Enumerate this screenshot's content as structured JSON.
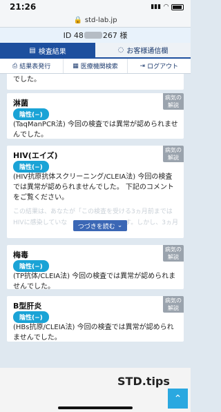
{
  "status_bar": {
    "time": "21:26"
  },
  "browser": {
    "url": "std-lab.jp"
  },
  "id_bar": {
    "prefix": "ID 48",
    "suffix": "267 様"
  },
  "tabs": [
    {
      "label": "検査結果"
    },
    {
      "label": "お客様通信欄"
    }
  ],
  "subnav": [
    {
      "label": "結果表発行"
    },
    {
      "label": "医療機関検索"
    },
    {
      "label": "ログアウト"
    }
  ],
  "top_fragment": "でした。",
  "cards": [
    {
      "title": "淋菌",
      "badge": "陰性(−)",
      "desc": "(TaqManPCR法) 今回の検査では異常が認められませんでした。",
      "disease_btn": "病気の解説"
    },
    {
      "title": "HIV(エイズ)",
      "badge": "陰性(−)",
      "desc": "(HIV抗原抗体スクリーニング/CLEIA法) 今回の検査では異常が認められませんでした。 下記のコメントをご覧ください。",
      "comment_line1": "この結果は、あなたが「この検査を受ける3ヵ月前までは",
      "comment_line2": "HIVに感染していな",
      "comment_line2b": "す。しかし、3ヵ月",
      "readmore": "つづきを読む",
      "disease_btn": "病気の解説"
    },
    {
      "title": "梅毒",
      "badge": "陰性(−)",
      "desc": "(TP抗体/CLEIA法) 今回の検査では異常が認められませんでした。",
      "disease_btn": "病気の解説"
    },
    {
      "title": "B型肝炎",
      "badge": "陰性(−)",
      "desc": "(HBs抗原/CLEIA法) 今回の検査では異常が認められませんでした。",
      "disease_btn": "病気の解説"
    }
  ],
  "footer": {
    "logo": "STD.tips"
  }
}
